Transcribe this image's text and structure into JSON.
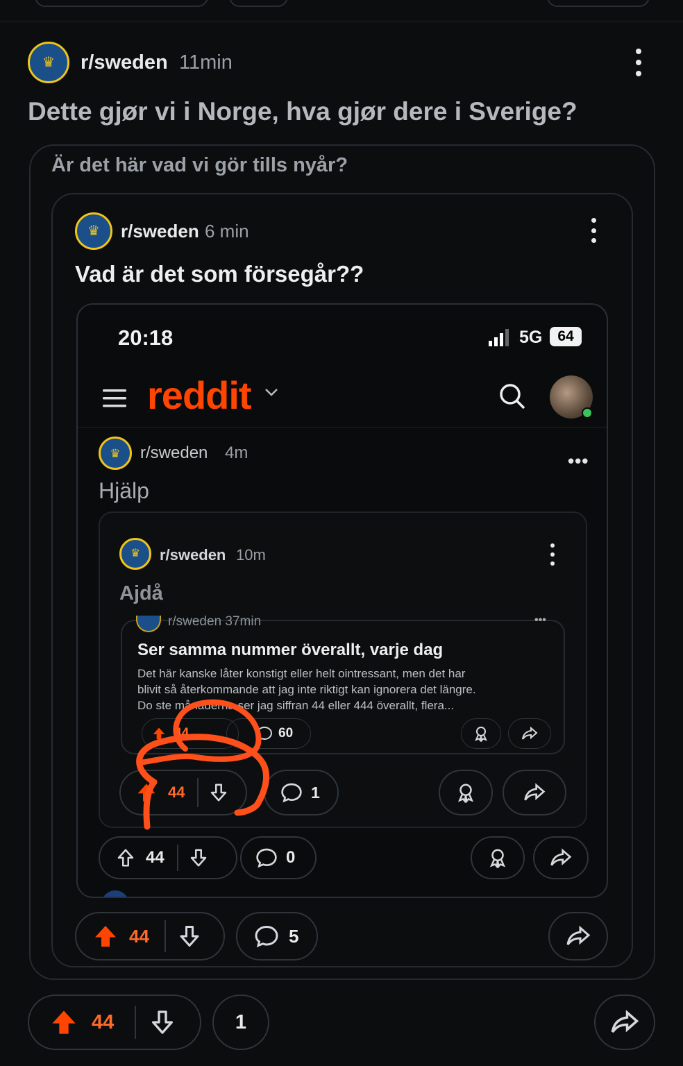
{
  "outer_post": {
    "subreddit": "r/sweden",
    "time": "11min",
    "title": "Dette gjør vi i Norge, hva gjør dere i Sverige?",
    "crosspost_title": "Är det här vad vi gör tills nyår?",
    "votes": "44",
    "comments": "1"
  },
  "second_post": {
    "subreddit": "r/sweden",
    "time": "6 min",
    "title": "Vad är det som försegår??",
    "votes": "44",
    "comments": "5"
  },
  "phone": {
    "status_time": "20:18",
    "network": "5G",
    "battery": "64",
    "logo": "reddit"
  },
  "third_post": {
    "subreddit": "r/sweden",
    "time": "4m",
    "title": "Hjälp",
    "votes": "44",
    "comments": "0"
  },
  "fourth_post": {
    "subreddit": "r/sweden",
    "time": "10m",
    "title": "Ajdå",
    "votes": "44",
    "comments": "1"
  },
  "fifth_post": {
    "subreddit": "r/sweden",
    "time": "37min",
    "title": "Ser samma nummer överallt, varje dag",
    "body_line1": "Det här kanske låter konstigt eller helt ointressant, men det har",
    "body_line2": "blivit så återkommande att jag inte riktigt kan ignorera det längre.",
    "body_line3": "Do       ste månaderna ser jag siffran 44 eller 444 överallt, flera...",
    "votes": "44",
    "comments": "60"
  },
  "colors": {
    "accent": "#ff4500",
    "annotation": "#ff4f1a",
    "background": "#0b0d0f"
  },
  "icons": [
    "upvote-icon",
    "downvote-icon",
    "comment-icon",
    "award-icon",
    "share-icon",
    "menu-icon",
    "search-icon",
    "more-icon",
    "signal-icon",
    "battery-icon",
    "chevron-down-icon"
  ]
}
